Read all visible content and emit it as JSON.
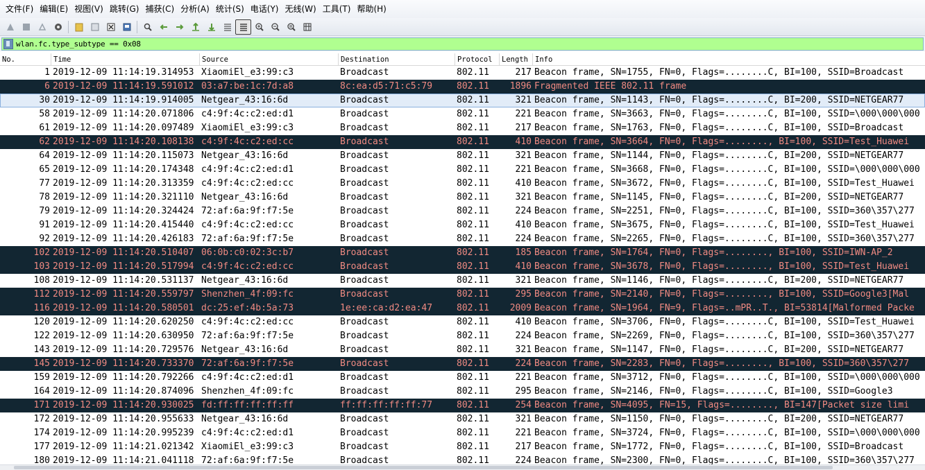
{
  "menu": [
    "文件(F)",
    "编辑(E)",
    "视图(V)",
    "跳转(G)",
    "捕获(C)",
    "分析(A)",
    "统计(S)",
    "电话(Y)",
    "无线(W)",
    "工具(T)",
    "帮助(H)"
  ],
  "toolbar": {
    "icons": [
      "shark-fin-start-icon",
      "stop-icon",
      "restart-icon",
      "options-gear-icon",
      "open-folder-icon",
      "save-file-icon",
      "close-file-icon",
      "reload-icon",
      "find-icon",
      "back-arrow-icon",
      "forward-arrow-icon",
      "go-to-packet-icon",
      "first-packet-icon",
      "last-packet-icon",
      "autoscroll-icon",
      "colorize-icon",
      "zoom-in-icon",
      "zoom-out-icon",
      "normal-size-icon",
      "resize-columns-icon"
    ]
  },
  "filter": {
    "value": "wlan.fc.type_subtype == 0x08",
    "bar_color": "#b0ff90"
  },
  "columns": [
    "No.",
    "Time",
    "Source",
    "Destination",
    "Protocol",
    "Length",
    "Info"
  ],
  "colors": {
    "dark_row_bg": "#122632",
    "dark_row_text": "#f08a82",
    "selected_row_bg": "#e2ecf8"
  },
  "packets": [
    {
      "no": "1",
      "time": "2019-12-09 11:14:19.314953",
      "src": "XiaomiEl_e3:99:c3",
      "dst": "Broadcast",
      "proto": "802.11",
      "len": "217",
      "info": "Beacon frame, SN=1755, FN=0, Flags=........C, BI=100, SSID=Broadcast",
      "style": "normal"
    },
    {
      "no": "6",
      "time": "2019-12-09 11:14:19.591012",
      "src": "03:a7:be:1c:7d:a8",
      "dst": "8c:ea:d5:71:c5:79",
      "proto": "802.11",
      "len": "1896",
      "info": "Fragmented IEEE 802.11 frame",
      "style": "dark"
    },
    {
      "no": "30",
      "time": "2019-12-09 11:14:19.914005",
      "src": "Netgear_43:16:6d",
      "dst": "Broadcast",
      "proto": "802.11",
      "len": "321",
      "info": "Beacon frame, SN=1143, FN=0, Flags=........C, BI=200, SSID=NETGEAR77",
      "style": "selected"
    },
    {
      "no": "58",
      "time": "2019-12-09 11:14:20.071806",
      "src": "c4:9f:4c:c2:ed:d1",
      "dst": "Broadcast",
      "proto": "802.11",
      "len": "221",
      "info": "Beacon frame, SN=3663, FN=0, Flags=........C, BI=100, SSID=\\000\\000\\000",
      "style": "normal"
    },
    {
      "no": "61",
      "time": "2019-12-09 11:14:20.097489",
      "src": "XiaomiEl_e3:99:c3",
      "dst": "Broadcast",
      "proto": "802.11",
      "len": "217",
      "info": "Beacon frame, SN=1763, FN=0, Flags=........C, BI=100, SSID=Broadcast",
      "style": "normal"
    },
    {
      "no": "62",
      "time": "2019-12-09 11:14:20.108138",
      "src": "c4:9f:4c:c2:ed:cc",
      "dst": "Broadcast",
      "proto": "802.11",
      "len": "410",
      "info": "Beacon frame, SN=3664, FN=0, Flags=........, BI=100, SSID=Test_Huawei",
      "style": "dark"
    },
    {
      "no": "64",
      "time": "2019-12-09 11:14:20.115073",
      "src": "Netgear_43:16:6d",
      "dst": "Broadcast",
      "proto": "802.11",
      "len": "321",
      "info": "Beacon frame, SN=1144, FN=0, Flags=........C, BI=200, SSID=NETGEAR77",
      "style": "normal"
    },
    {
      "no": "65",
      "time": "2019-12-09 11:14:20.174348",
      "src": "c4:9f:4c:c2:ed:d1",
      "dst": "Broadcast",
      "proto": "802.11",
      "len": "221",
      "info": "Beacon frame, SN=3668, FN=0, Flags=........C, BI=100, SSID=\\000\\000\\000",
      "style": "normal"
    },
    {
      "no": "77",
      "time": "2019-12-09 11:14:20.313359",
      "src": "c4:9f:4c:c2:ed:cc",
      "dst": "Broadcast",
      "proto": "802.11",
      "len": "410",
      "info": "Beacon frame, SN=3672, FN=0, Flags=........C, BI=100, SSID=Test_Huawei",
      "style": "normal"
    },
    {
      "no": "78",
      "time": "2019-12-09 11:14:20.321110",
      "src": "Netgear_43:16:6d",
      "dst": "Broadcast",
      "proto": "802.11",
      "len": "321",
      "info": "Beacon frame, SN=1145, FN=0, Flags=........C, BI=200, SSID=NETGEAR77",
      "style": "normal"
    },
    {
      "no": "79",
      "time": "2019-12-09 11:14:20.324424",
      "src": "72:af:6a:9f:f7:5e",
      "dst": "Broadcast",
      "proto": "802.11",
      "len": "224",
      "info": "Beacon frame, SN=2251, FN=0, Flags=........C, BI=100, SSID=360\\357\\277",
      "style": "normal"
    },
    {
      "no": "91",
      "time": "2019-12-09 11:14:20.415440",
      "src": "c4:9f:4c:c2:ed:cc",
      "dst": "Broadcast",
      "proto": "802.11",
      "len": "410",
      "info": "Beacon frame, SN=3675, FN=0, Flags=........C, BI=100, SSID=Test_Huawei",
      "style": "normal"
    },
    {
      "no": "92",
      "time": "2019-12-09 11:14:20.426183",
      "src": "72:af:6a:9f:f7:5e",
      "dst": "Broadcast",
      "proto": "802.11",
      "len": "224",
      "info": "Beacon frame, SN=2265, FN=0, Flags=........C, BI=100, SSID=360\\357\\277",
      "style": "normal"
    },
    {
      "no": "102",
      "time": "2019-12-09 11:14:20.510407",
      "src": "06:0b:c0:02:3c:b7",
      "dst": "Broadcast",
      "proto": "802.11",
      "len": "185",
      "info": "Beacon frame, SN=1764, FN=0, Flags=........, BI=100, SSID=IWN-AP_2",
      "style": "dark"
    },
    {
      "no": "103",
      "time": "2019-12-09 11:14:20.517994",
      "src": "c4:9f:4c:c2:ed:cc",
      "dst": "Broadcast",
      "proto": "802.11",
      "len": "410",
      "info": "Beacon frame, SN=3678, FN=0, Flags=........, BI=100, SSID=Test_Huawei",
      "style": "dark"
    },
    {
      "no": "108",
      "time": "2019-12-09 11:14:20.531137",
      "src": "Netgear_43:16:6d",
      "dst": "Broadcast",
      "proto": "802.11",
      "len": "321",
      "info": "Beacon frame, SN=1146, FN=0, Flags=........C, BI=200, SSID=NETGEAR77",
      "style": "normal"
    },
    {
      "no": "112",
      "time": "2019-12-09 11:14:20.559797",
      "src": "Shenzhen_4f:09:fc",
      "dst": "Broadcast",
      "proto": "802.11",
      "len": "295",
      "info": "Beacon frame, SN=2140, FN=0, Flags=........, BI=100, SSID=Google3[Mal",
      "style": "dark"
    },
    {
      "no": "116",
      "time": "2019-12-09 11:14:20.580501",
      "src": "dc:25:ef:4b:5a:73",
      "dst": "1e:ee:ca:d2:ea:47",
      "proto": "802.11",
      "len": "2009",
      "info": "Beacon frame, SN=1964, FN=9, Flags=..mPR..T., BI=53814[Malformed Packe",
      "style": "dark"
    },
    {
      "no": "120",
      "time": "2019-12-09 11:14:20.620250",
      "src": "c4:9f:4c:c2:ed:cc",
      "dst": "Broadcast",
      "proto": "802.11",
      "len": "410",
      "info": "Beacon frame, SN=3706, FN=0, Flags=........C, BI=100, SSID=Test_Huawei",
      "style": "normal"
    },
    {
      "no": "122",
      "time": "2019-12-09 11:14:20.630950",
      "src": "72:af:6a:9f:f7:5e",
      "dst": "Broadcast",
      "proto": "802.11",
      "len": "224",
      "info": "Beacon frame, SN=2269, FN=0, Flags=........C, BI=100, SSID=360\\357\\277",
      "style": "normal"
    },
    {
      "no": "143",
      "time": "2019-12-09 11:14:20.729576",
      "src": "Netgear_43:16:6d",
      "dst": "Broadcast",
      "proto": "802.11",
      "len": "321",
      "info": "Beacon frame, SN=1147, FN=0, Flags=........C, BI=200, SSID=NETGEAR77",
      "style": "normal"
    },
    {
      "no": "145",
      "time": "2019-12-09 11:14:20.733370",
      "src": "72:af:6a:9f:f7:5e",
      "dst": "Broadcast",
      "proto": "802.11",
      "len": "224",
      "info": "Beacon frame, SN=2283, FN=0, Flags=........, BI=100, SSID=360\\357\\277",
      "style": "dark"
    },
    {
      "no": "159",
      "time": "2019-12-09 11:14:20.792266",
      "src": "c4:9f:4c:c2:ed:d1",
      "dst": "Broadcast",
      "proto": "802.11",
      "len": "221",
      "info": "Beacon frame, SN=3712, FN=0, Flags=........C, BI=100, SSID=\\000\\000\\000",
      "style": "normal"
    },
    {
      "no": "164",
      "time": "2019-12-09 11:14:20.874096",
      "src": "Shenzhen_4f:09:fc",
      "dst": "Broadcast",
      "proto": "802.11",
      "len": "295",
      "info": "Beacon frame, SN=2146, FN=0, Flags=........C, BI=100, SSID=Google3",
      "style": "normal"
    },
    {
      "no": "171",
      "time": "2019-12-09 11:14:20.930025",
      "src": "fd:ff:ff:ff:ff:ff",
      "dst": "ff:ff:ff:ff:ff:77",
      "proto": "802.11",
      "len": "254",
      "info": "Beacon frame, SN=4095, FN=15, Flags=........, BI=147[Packet size limi",
      "style": "dark"
    },
    {
      "no": "172",
      "time": "2019-12-09 11:14:20.955633",
      "src": "Netgear_43:16:6d",
      "dst": "Broadcast",
      "proto": "802.11",
      "len": "321",
      "info": "Beacon frame, SN=1150, FN=0, Flags=........C, BI=200, SSID=NETGEAR77",
      "style": "normal"
    },
    {
      "no": "174",
      "time": "2019-12-09 11:14:20.995239",
      "src": "c4:9f:4c:c2:ed:d1",
      "dst": "Broadcast",
      "proto": "802.11",
      "len": "221",
      "info": "Beacon frame, SN=3724, FN=0, Flags=........C, BI=100, SSID=\\000\\000\\000",
      "style": "normal"
    },
    {
      "no": "177",
      "time": "2019-12-09 11:14:21.021342",
      "src": "XiaomiEl_e3:99:c3",
      "dst": "Broadcast",
      "proto": "802.11",
      "len": "217",
      "info": "Beacon frame, SN=1772, FN=0, Flags=........C, BI=100, SSID=Broadcast",
      "style": "normal"
    },
    {
      "no": "180",
      "time": "2019-12-09 11:14:21.041118",
      "src": "72:af:6a:9f:f7:5e",
      "dst": "Broadcast",
      "proto": "802.11",
      "len": "224",
      "info": "Beacon frame, SN=2300, FN=0, Flags=........C, BI=100, SSID=360\\357\\277",
      "style": "normal"
    }
  ]
}
